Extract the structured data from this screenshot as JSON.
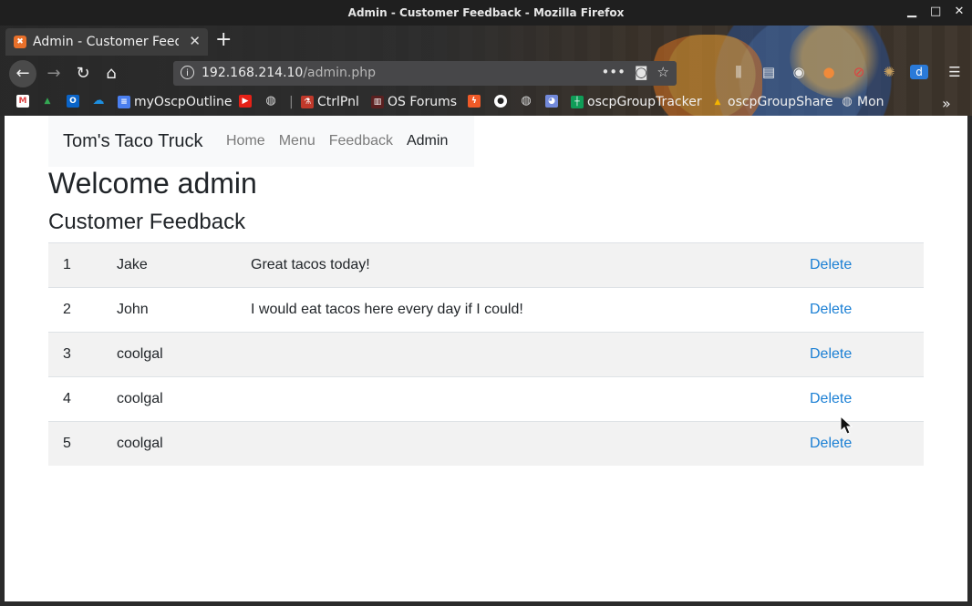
{
  "window": {
    "title": "Admin - Customer Feedback - Mozilla Firefox"
  },
  "tab": {
    "title": "Admin - Customer Feedb",
    "close": "✕",
    "new_tab": "+"
  },
  "urlbar": {
    "host": "192.168.214.10",
    "path": "/admin.php",
    "more": "•••"
  },
  "bookmarks": [
    {
      "label": "",
      "icon": "gmail-icon",
      "color": "#ffffff"
    },
    {
      "label": "",
      "icon": "google-drive-icon",
      "color": "#34a853"
    },
    {
      "label": "",
      "icon": "outlook-icon",
      "color": "#0a64c8"
    },
    {
      "label": "",
      "icon": "onedrive-icon",
      "color": "#1d8fe0"
    },
    {
      "label": "myOscpOutline",
      "icon": "google-docs-icon",
      "color": "#4a7ff0"
    },
    {
      "label": "",
      "icon": "youtube-icon",
      "color": "#e62117"
    },
    {
      "label": "",
      "icon": "globe-icon",
      "color": "#cccccc"
    },
    {
      "label": "CtrlPnl",
      "icon": "ctrlpnl-icon",
      "color": "#c0392b"
    },
    {
      "label": "OS Forums",
      "icon": "os-forums-icon",
      "color": "#8a2b2b"
    },
    {
      "label": "",
      "icon": "bolt-icon",
      "color": "#f05a28"
    },
    {
      "label": "",
      "icon": "github-icon",
      "color": "#ffffff"
    },
    {
      "label": "",
      "icon": "globe-icon",
      "color": "#cccccc"
    },
    {
      "label": "",
      "icon": "discord-icon",
      "color": "#7289da"
    },
    {
      "label": "oscpGroupTracker",
      "icon": "google-sheets-icon",
      "color": "#0f9d58"
    },
    {
      "label": "oscpGroupShare",
      "icon": "google-drive-icon",
      "color": "#f4b400"
    },
    {
      "label": "Mon",
      "icon": "globe-icon",
      "color": "#cccccc"
    }
  ],
  "site": {
    "brand": "Tom's Taco Truck",
    "nav": [
      "Home",
      "Menu",
      "Feedback",
      "Admin"
    ],
    "heading": "Welcome admin",
    "subheading": "Customer Feedback",
    "rows": [
      {
        "id": "1",
        "name": "Jake",
        "message": "Great tacos today!",
        "action": "Delete"
      },
      {
        "id": "2",
        "name": "John",
        "message": "I would eat tacos here every day if I could!",
        "action": "Delete"
      },
      {
        "id": "3",
        "name": "coolgal",
        "message": "",
        "action": "Delete"
      },
      {
        "id": "4",
        "name": "coolgal",
        "message": "",
        "action": "Delete"
      },
      {
        "id": "5",
        "name": "coolgal",
        "message": "",
        "action": "Delete"
      }
    ]
  }
}
